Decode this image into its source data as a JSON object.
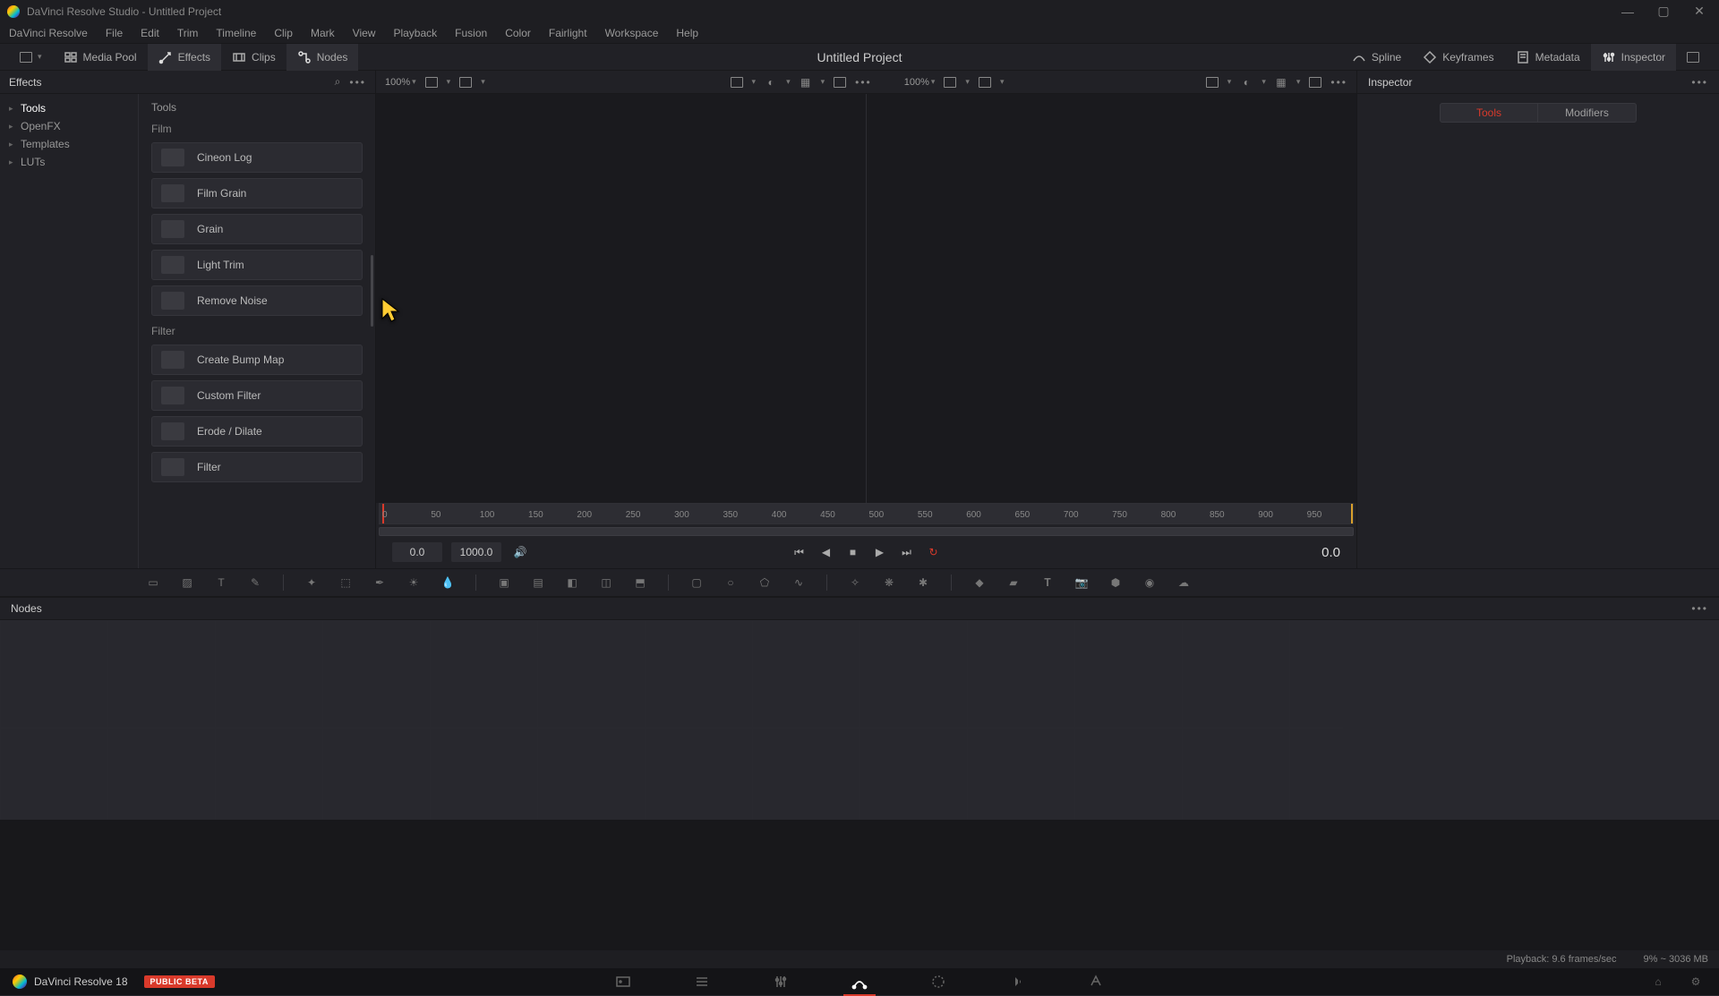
{
  "window": {
    "title": "DaVinci Resolve Studio - Untitled Project"
  },
  "menu": [
    "DaVinci Resolve",
    "File",
    "Edit",
    "Trim",
    "Timeline",
    "Clip",
    "Mark",
    "View",
    "Playback",
    "Fusion",
    "Color",
    "Fairlight",
    "Workspace",
    "Help"
  ],
  "workspace": {
    "left": [
      {
        "icon": "panel",
        "label": ""
      },
      {
        "icon": "mediapool",
        "label": "Media Pool"
      },
      {
        "icon": "fx",
        "label": "Effects"
      },
      {
        "icon": "clips",
        "label": "Clips"
      },
      {
        "icon": "nodes",
        "label": "Nodes"
      }
    ],
    "project_title": "Untitled Project",
    "right": [
      {
        "icon": "spline",
        "label": "Spline"
      },
      {
        "icon": "keyframes",
        "label": "Keyframes"
      },
      {
        "icon": "metadata",
        "label": "Metadata"
      },
      {
        "icon": "inspector",
        "label": "Inspector"
      }
    ]
  },
  "effects": {
    "title": "Effects",
    "tree": [
      {
        "label": "Tools",
        "active": true,
        "arrow": true
      },
      {
        "label": "OpenFX",
        "active": false,
        "arrow": true
      },
      {
        "label": "Templates",
        "active": false,
        "arrow": true
      },
      {
        "label": "LUTs",
        "active": false,
        "arrow": true
      }
    ],
    "list_title": "Tools",
    "groups": [
      {
        "name": "Film",
        "items": [
          "Cineon Log",
          "Film Grain",
          "Grain",
          "Light Trim",
          "Remove Noise"
        ]
      },
      {
        "name": "Filter",
        "items": [
          "Create Bump Map",
          "Custom Filter",
          "Erode / Dilate",
          "Filter"
        ]
      }
    ]
  },
  "viewer": {
    "zoom_left": "100%",
    "zoom_right": "100%"
  },
  "ruler": {
    "ticks": [
      "0",
      "50",
      "100",
      "150",
      "200",
      "250",
      "300",
      "350",
      "400",
      "450",
      "500",
      "550",
      "600",
      "650",
      "700",
      "750",
      "800",
      "850",
      "900",
      "950"
    ]
  },
  "transport": {
    "start": "0.0",
    "end": "1000.0",
    "current": "0.0"
  },
  "inspector": {
    "title": "Inspector",
    "tabs": [
      "Tools",
      "Modifiers"
    ]
  },
  "nodes": {
    "title": "Nodes"
  },
  "status": {
    "playback": "Playback: 9.6 frames/sec",
    "mem": "9% ~ 3036 MB"
  },
  "pagebar": {
    "brand": "DaVinci Resolve 18",
    "beta": "PUBLIC BETA"
  }
}
